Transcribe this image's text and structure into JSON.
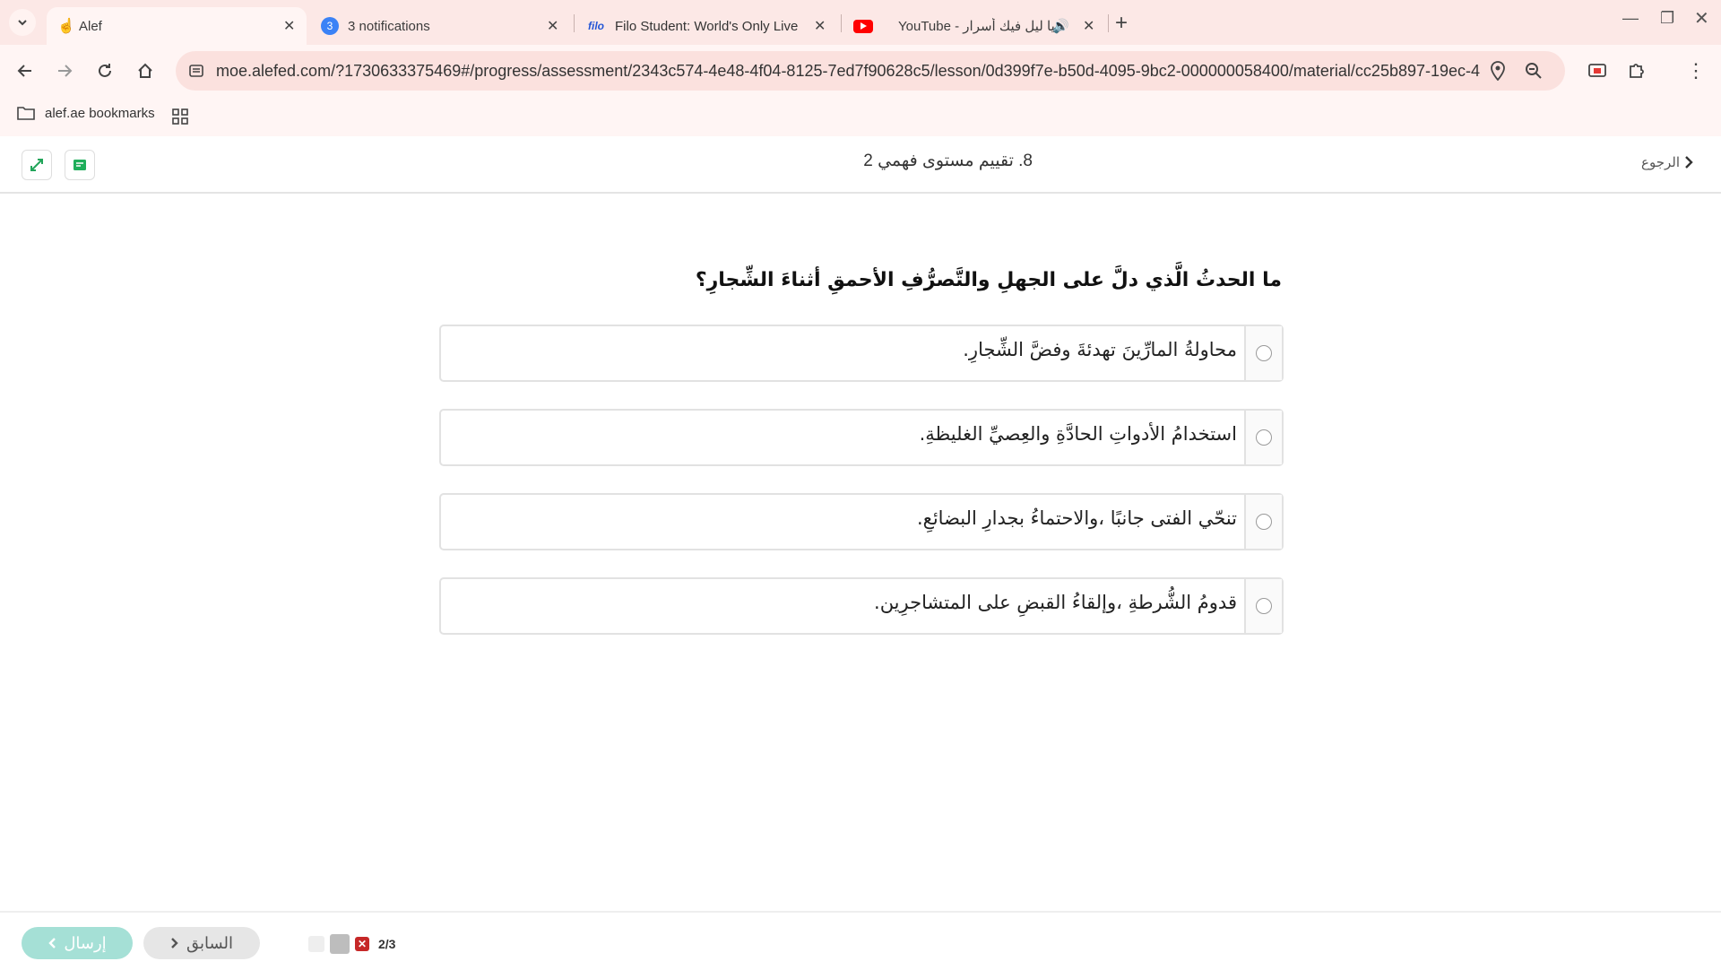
{
  "browser": {
    "tabs": [
      {
        "title": "Alef",
        "active": true
      },
      {
        "title": "3 notifications",
        "badge": "3"
      },
      {
        "title": "Filo Student: World's Only Live I",
        "favicon_text": "filo"
      },
      {
        "title": "YouTube - يا ليل فيك أسرار"
      }
    ],
    "url": "moe.alefed.com/?1730633375469#/progress/assessment/2343c574-4e48-4f04-8125-7ed7f90628c5/lesson/0d399f7e-b50d-4095-9bc2-000000058400/material/cc25b897-19ec-4...",
    "bookmark_folder": "alef.ae bookmarks"
  },
  "header": {
    "title": "8. تقييم مستوى فهمي 2",
    "back_label": "الرجوع"
  },
  "quiz": {
    "question": "ما الحدثُ الَّذي دلَّ على الجهلِ والتَّصرُّفِ الأحمقِ أثناءَ الشِّجارِ؟",
    "options": [
      "محاولةُ المارِّينَ تهدئةَ وفضَّ الشِّجارِ.",
      "استخدامُ الأدواتِ الحادَّةِ والعِصيِّ الغليظةِ.",
      "تنحّي الفتى جانبًا ،والاحتماءُ بجدارِ البضائعِ.",
      "قدومُ الشُّرطةِ ،وإلقاءُ القبضِ على المتشاجرِين."
    ]
  },
  "footer": {
    "submit_label": "إرسال",
    "previous_label": "السابق",
    "progress_text": "2/3"
  },
  "colors": {
    "chrome_bg": "#fce8e6",
    "submit_bg": "#a5e0d6",
    "wrong_mark": "#c62828",
    "sheet_icon": "#1fae5b"
  }
}
